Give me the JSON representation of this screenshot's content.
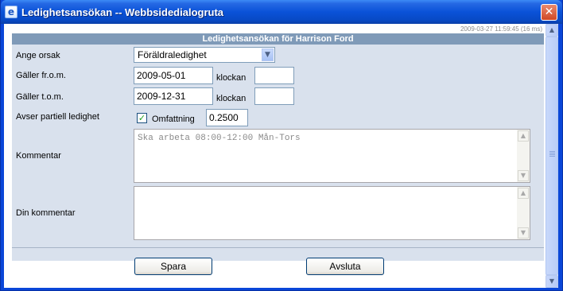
{
  "window": {
    "title": "Ledighetsansökan -- Webbsidedialogruta",
    "app_icon": "ie-icon",
    "close_icon": "close-icon"
  },
  "timestamp": "2009-03-27 11:59:45 (16 ms)",
  "header": "Ledighetsansökan för Harrison Ford",
  "form": {
    "reason_label": "Ange orsak",
    "reason_value": "Föräldraledighet",
    "from_label": "Gäller fr.o.m.",
    "from_date": "2009-05-01",
    "from_time_label": "klockan",
    "from_time": "",
    "to_label": "Gäller t.o.m.",
    "to_date": "2009-12-31",
    "to_time_label": "klockan",
    "to_time": "",
    "partial_label": "Avser partiell ledighet",
    "partial_checked": true,
    "extent_label": "Omfattning",
    "extent_value": "0.2500",
    "comment_label": "Kommentar",
    "comment_value": "Ska arbeta 08:00-12:00 Mån-Tors",
    "your_comment_label": "Din kommentar",
    "your_comment_value": ""
  },
  "buttons": {
    "save": "Spara",
    "close": "Avsluta"
  }
}
